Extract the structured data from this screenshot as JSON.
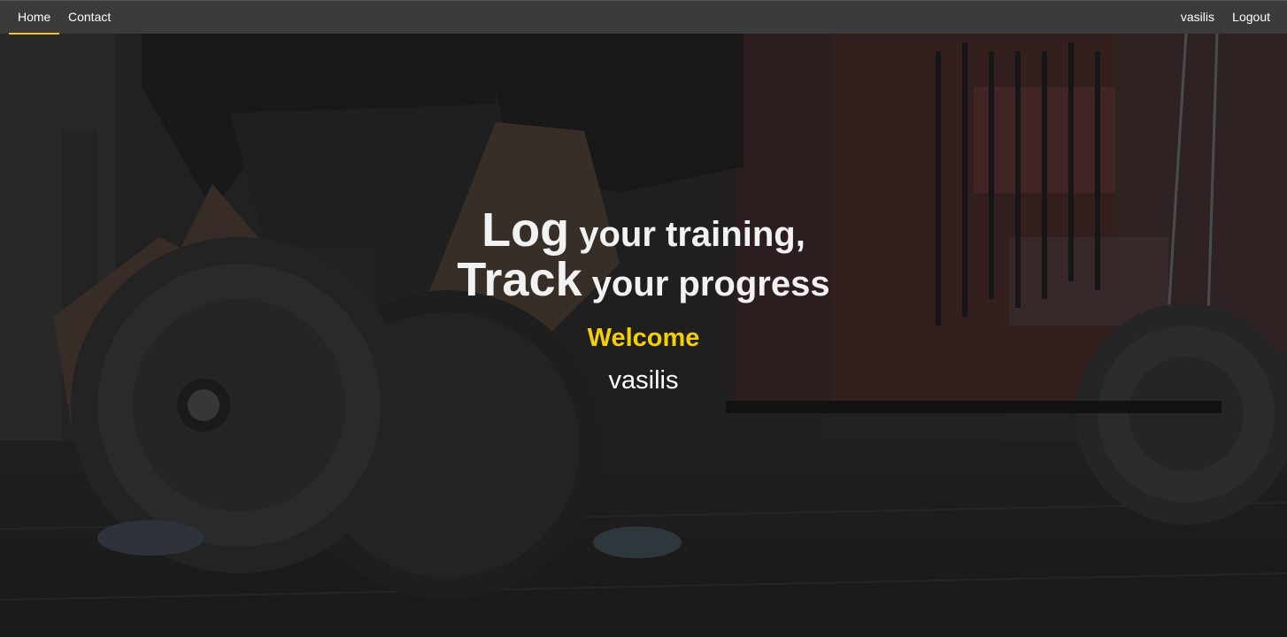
{
  "nav": {
    "left": [
      {
        "label": "Home",
        "active": true
      },
      {
        "label": "Contact",
        "active": false
      }
    ],
    "right": [
      {
        "label": "vasilis"
      },
      {
        "label": "Logout"
      }
    ]
  },
  "hero": {
    "background": "gym-barbell-photo",
    "headline": {
      "line1": {
        "big": "Log",
        "rest": " your training,"
      },
      "line2": {
        "big": "Track",
        "rest": " your progress"
      }
    },
    "welcome": "Welcome",
    "username": "vasilis"
  },
  "colors": {
    "navbar": "#3b3b3b",
    "accent": "#f5c518",
    "welcome": "#f5d000",
    "text": "#ffffff"
  }
}
